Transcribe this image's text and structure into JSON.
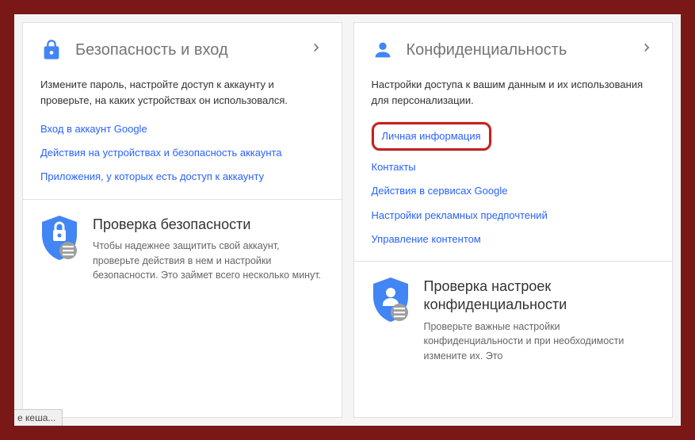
{
  "cards": {
    "security": {
      "title": "Безопасность и вход",
      "description": "Измените пароль, настройте доступ к аккаунту и проверьте, на каких устройствах он использовался.",
      "links": [
        "Вход в аккаунт Google",
        "Действия на устройствах и безопасность аккаунта",
        "Приложения, у которых есть доступ к аккаунту"
      ],
      "subcard": {
        "title": "Проверка безопасности",
        "description": "Чтобы надежнее защитить свой аккаунт, проверьте действия в нем и настройки безопасности. Это займет всего несколько минут."
      }
    },
    "privacy": {
      "title": "Конфиденциальность",
      "description": "Настройки доступа к вашим данным и их использования для персонализации.",
      "links": [
        "Личная информация",
        "Контакты",
        "Действия в сервисах Google",
        "Настройки рекламных предпочтений",
        "Управление контентом"
      ],
      "subcard": {
        "title": "Проверка настроек конфиденциальности",
        "description": "Проверьте важные настройки конфиденциальности и при необходимости измените их. Это"
      }
    }
  },
  "status_text": "е кеша...",
  "colors": {
    "link": "#2962ff",
    "highlight_border": "#c62020",
    "icon_blue": "#4285f4"
  }
}
